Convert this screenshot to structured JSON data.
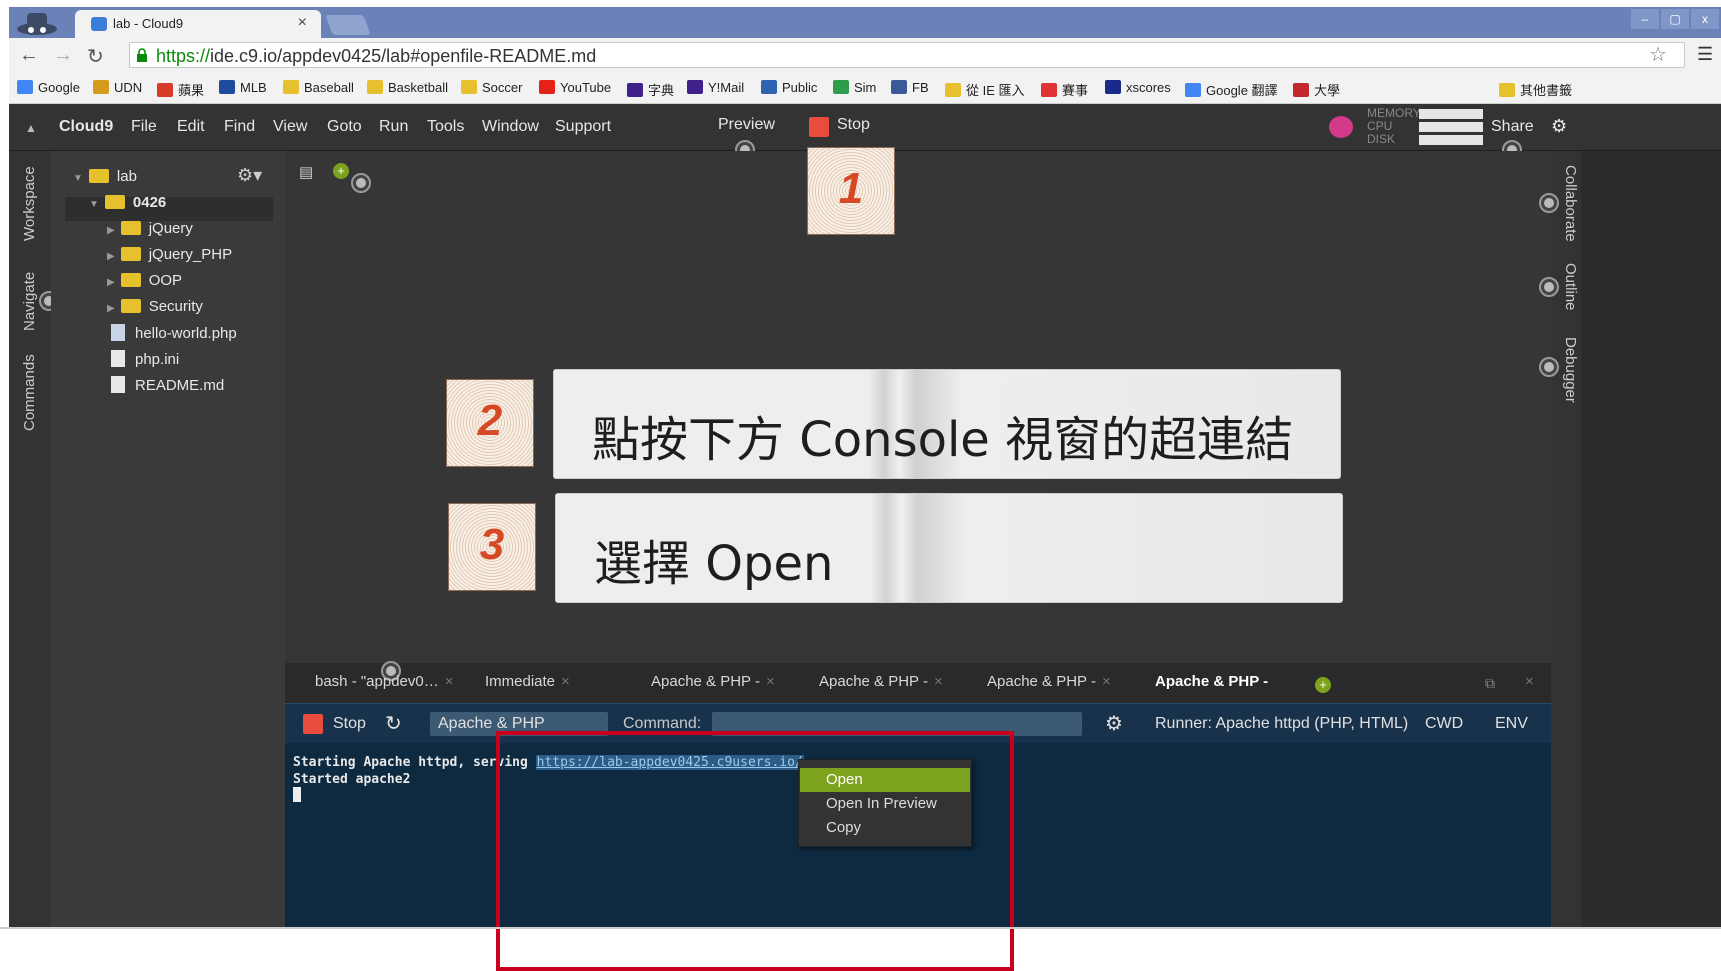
{
  "browser": {
    "tab_title": "lab - Cloud9",
    "tab_close": "×",
    "url_scheme": "https://",
    "url_rest": "ide.c9.io/appdev0425/lab#openfile-README.md",
    "window_buttons": [
      "–",
      "▢",
      "x"
    ]
  },
  "bookmarks": [
    {
      "label": "Google",
      "color": "#4285f4"
    },
    {
      "label": "UDN",
      "color": "#d49b1f"
    },
    {
      "label": "蘋果",
      "color": "#d83a2a"
    },
    {
      "label": "MLB",
      "color": "#1d4c9c"
    },
    {
      "label": "Baseball",
      "color": "#e7c02e"
    },
    {
      "label": "Basketball",
      "color": "#e7c02e"
    },
    {
      "label": "Soccer",
      "color": "#e7c02e"
    },
    {
      "label": "YouTube",
      "color": "#e62117"
    },
    {
      "label": "字典",
      "color": "#40208a"
    },
    {
      "label": "Y!Mail",
      "color": "#40208a"
    },
    {
      "label": "Public",
      "color": "#2d63b0"
    },
    {
      "label": "Sim",
      "color": "#2d9c4b"
    },
    {
      "label": "FB",
      "color": "#3b5998"
    },
    {
      "label": "從 IE 匯入",
      "color": "#e7c02e"
    },
    {
      "label": "賽事",
      "color": "#e03333"
    },
    {
      "label": "xscores",
      "color": "#1a2a8a"
    },
    {
      "label": "Google 翻譯",
      "color": "#4285f4"
    },
    {
      "label": "大學",
      "color": "#c0282d"
    },
    {
      "label": "其他書籤",
      "color": "#e7c02e"
    }
  ],
  "ide": {
    "menu": [
      "Cloud9",
      "File",
      "Edit",
      "Find",
      "View",
      "Goto",
      "Run",
      "Tools",
      "Window",
      "Support"
    ],
    "preview": "Preview",
    "stop": "Stop",
    "share": "Share",
    "metrics": [
      "MEMORY",
      "CPU",
      "DISK"
    ]
  },
  "sidebar": {
    "left_tabs": [
      "Workspace",
      "Navigate",
      "Commands"
    ],
    "right_tabs": [
      "Collaborate",
      "Outline",
      "Debugger"
    ]
  },
  "tree": {
    "root": "lab",
    "selected_folder": "0426",
    "folders": [
      "jQuery",
      "jQuery_PHP",
      "OOP",
      "Security"
    ],
    "files": [
      "hello-world.php",
      "php.ini",
      "README.md"
    ]
  },
  "callouts": {
    "step1": "1",
    "step2": "2",
    "step2_text": "點按下方 Console 視窗的超連結",
    "step3": "3",
    "step3_text": "選擇  Open"
  },
  "console": {
    "tabs": [
      "bash - \"appdev0…",
      "Immediate",
      "Apache & PHP -",
      "Apache & PHP -",
      "Apache & PHP -",
      "Apache & PHP -"
    ],
    "stop": "Stop",
    "runner_name": "Apache & PHP",
    "command_label": "Command:",
    "runner": "Runner: Apache httpd (PHP, HTML)",
    "cwd": "CWD",
    "env": "ENV",
    "line1_prefix": "Starting Apache httpd, serving ",
    "line1_link": "https://lab-appdev0425.c9users.io/",
    "line2": "Started apache2"
  },
  "context_menu": [
    "Open",
    "Open In Preview",
    "Copy"
  ],
  "colors": {
    "accent": "#7da21e",
    "stop": "#e74c3c",
    "folder": "#e7c02e",
    "highlight_box": "#c8001e"
  }
}
